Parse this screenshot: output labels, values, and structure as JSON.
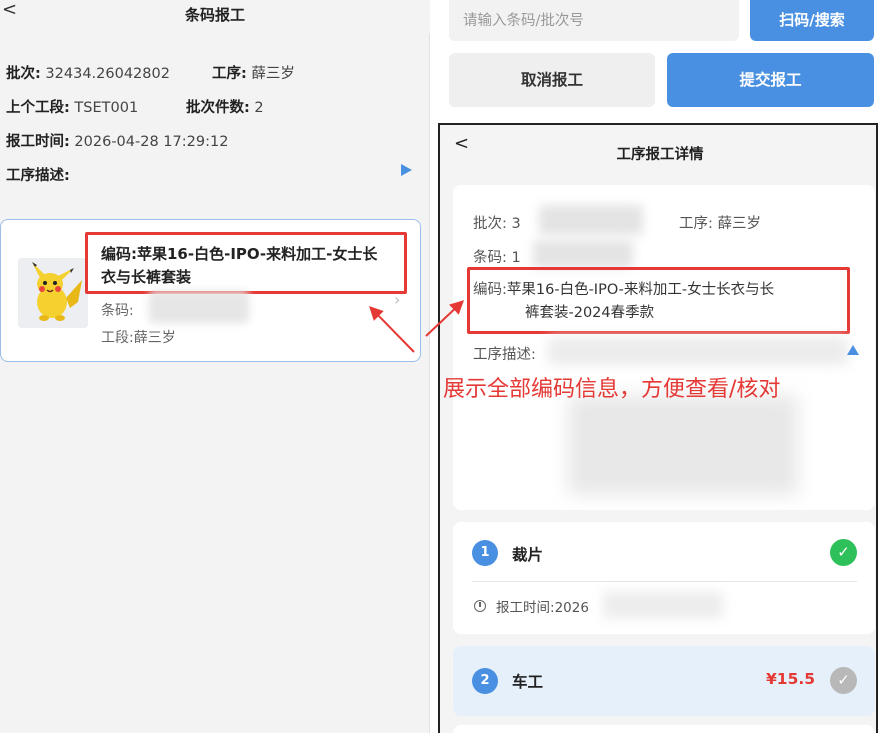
{
  "left": {
    "header": {
      "back_glyph": "<",
      "title": "条码报工"
    },
    "info": {
      "batch_label": "批次:",
      "batch_value": "32434.26042802",
      "process_label": "工序:",
      "process_value": "薛三岁",
      "prev_section_label": "上个工段:",
      "prev_section_value": "TSET001",
      "batch_qty_label": "批次件数:",
      "batch_qty_value": "2",
      "report_time_label": "报工时间:",
      "report_time_value": "2026-04-28 17:29:12",
      "process_desc_label": "工序描述:"
    },
    "item": {
      "code_label": "编码:",
      "code_value": "苹果16-白色-IPO-来料加工-女士长衣与长裤套装",
      "barcode_label": "条码:",
      "process_label": "工段:",
      "process_value": "薛三岁",
      "chevron": "›"
    }
  },
  "right": {
    "search": {
      "placeholder": "请输入条码/批次号"
    },
    "scan_button": "扫码/搜索",
    "cancel_button": "取消报工",
    "submit_button": "提交报工",
    "detail": {
      "back_glyph": "<",
      "title": "工序报工详情",
      "batch_label": "批次:",
      "batch_value_visible": "3",
      "process_label": "工序:",
      "process_value": "薛三岁",
      "barcode_label": "条码:",
      "barcode_value_visible": "1",
      "code_label": "编码:",
      "code_value_line1": "苹果16-白色-IPO-来料加工-女士长衣与长",
      "code_value_line2": "裤套装-2024春季款",
      "desc_label": "工序描述:"
    },
    "annotation": "展示全部编码信息，方便查看/核对",
    "steps": [
      {
        "num": "1",
        "name": "裁片",
        "time_label": "报工时间:",
        "time_visible": "2026",
        "check": "✓"
      },
      {
        "num": "2",
        "name": "车工",
        "price": "¥15.5",
        "check": "✓"
      }
    ]
  },
  "colors": {
    "accent": "#4a90e2",
    "annotation_red": "#e53935",
    "done_green": "#2ec05a",
    "pending_gray": "#b8b8b8"
  },
  "icons": [
    "back-icon",
    "play-arrow-icon",
    "chevron-right-icon",
    "collapse-arrow-icon",
    "check-icon",
    "clock-icon"
  ]
}
